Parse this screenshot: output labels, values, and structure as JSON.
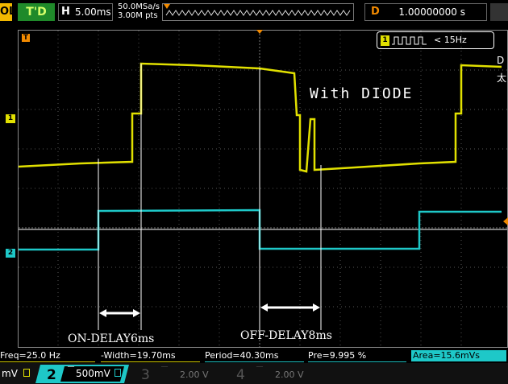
{
  "topbar": {
    "brand": "OL",
    "trigger_status": "T'D",
    "horizontal": {
      "key": "H",
      "value": "5.00ms"
    },
    "sample_rate": "50.0MSa/s",
    "memory_depth": "3.00M pts",
    "delay": {
      "key": "D",
      "value": "1.00000000 s"
    }
  },
  "screen": {
    "annotation_title": "With DIODE",
    "freq_counter": {
      "channel": "1",
      "value": "< 15Hz"
    },
    "on_delay": "ON-DELAY6ms",
    "off_delay": "OFF-DELAY8ms",
    "ch1_marker": "1",
    "ch2_marker": "2",
    "trigger_marker": "T",
    "right_edge_text": "D\n太"
  },
  "measurements": [
    {
      "text": "Freq=25.0 Hz",
      "color": "yellow"
    },
    {
      "text": "-Width=19.70ms",
      "color": "yellow"
    },
    {
      "text": "Period=40.30ms",
      "color": "cyan"
    },
    {
      "text": "Pre=9.995 %",
      "color": "cyan"
    },
    {
      "text": "Area=15.6mVs",
      "color": "cyan"
    }
  ],
  "channels": [
    {
      "label": "mV",
      "value": "",
      "active": true
    },
    {
      "label": "2",
      "value": "500mV",
      "active": true
    },
    {
      "label": "3",
      "value": "2.00 V",
      "active": false
    },
    {
      "label": "4",
      "value": "2.00 V",
      "active": false
    }
  ],
  "colors": {
    "ch1": "#e1e000",
    "ch2": "#1ec8c8",
    "trigger": "#f28a00",
    "brand": "#f2b800"
  }
}
